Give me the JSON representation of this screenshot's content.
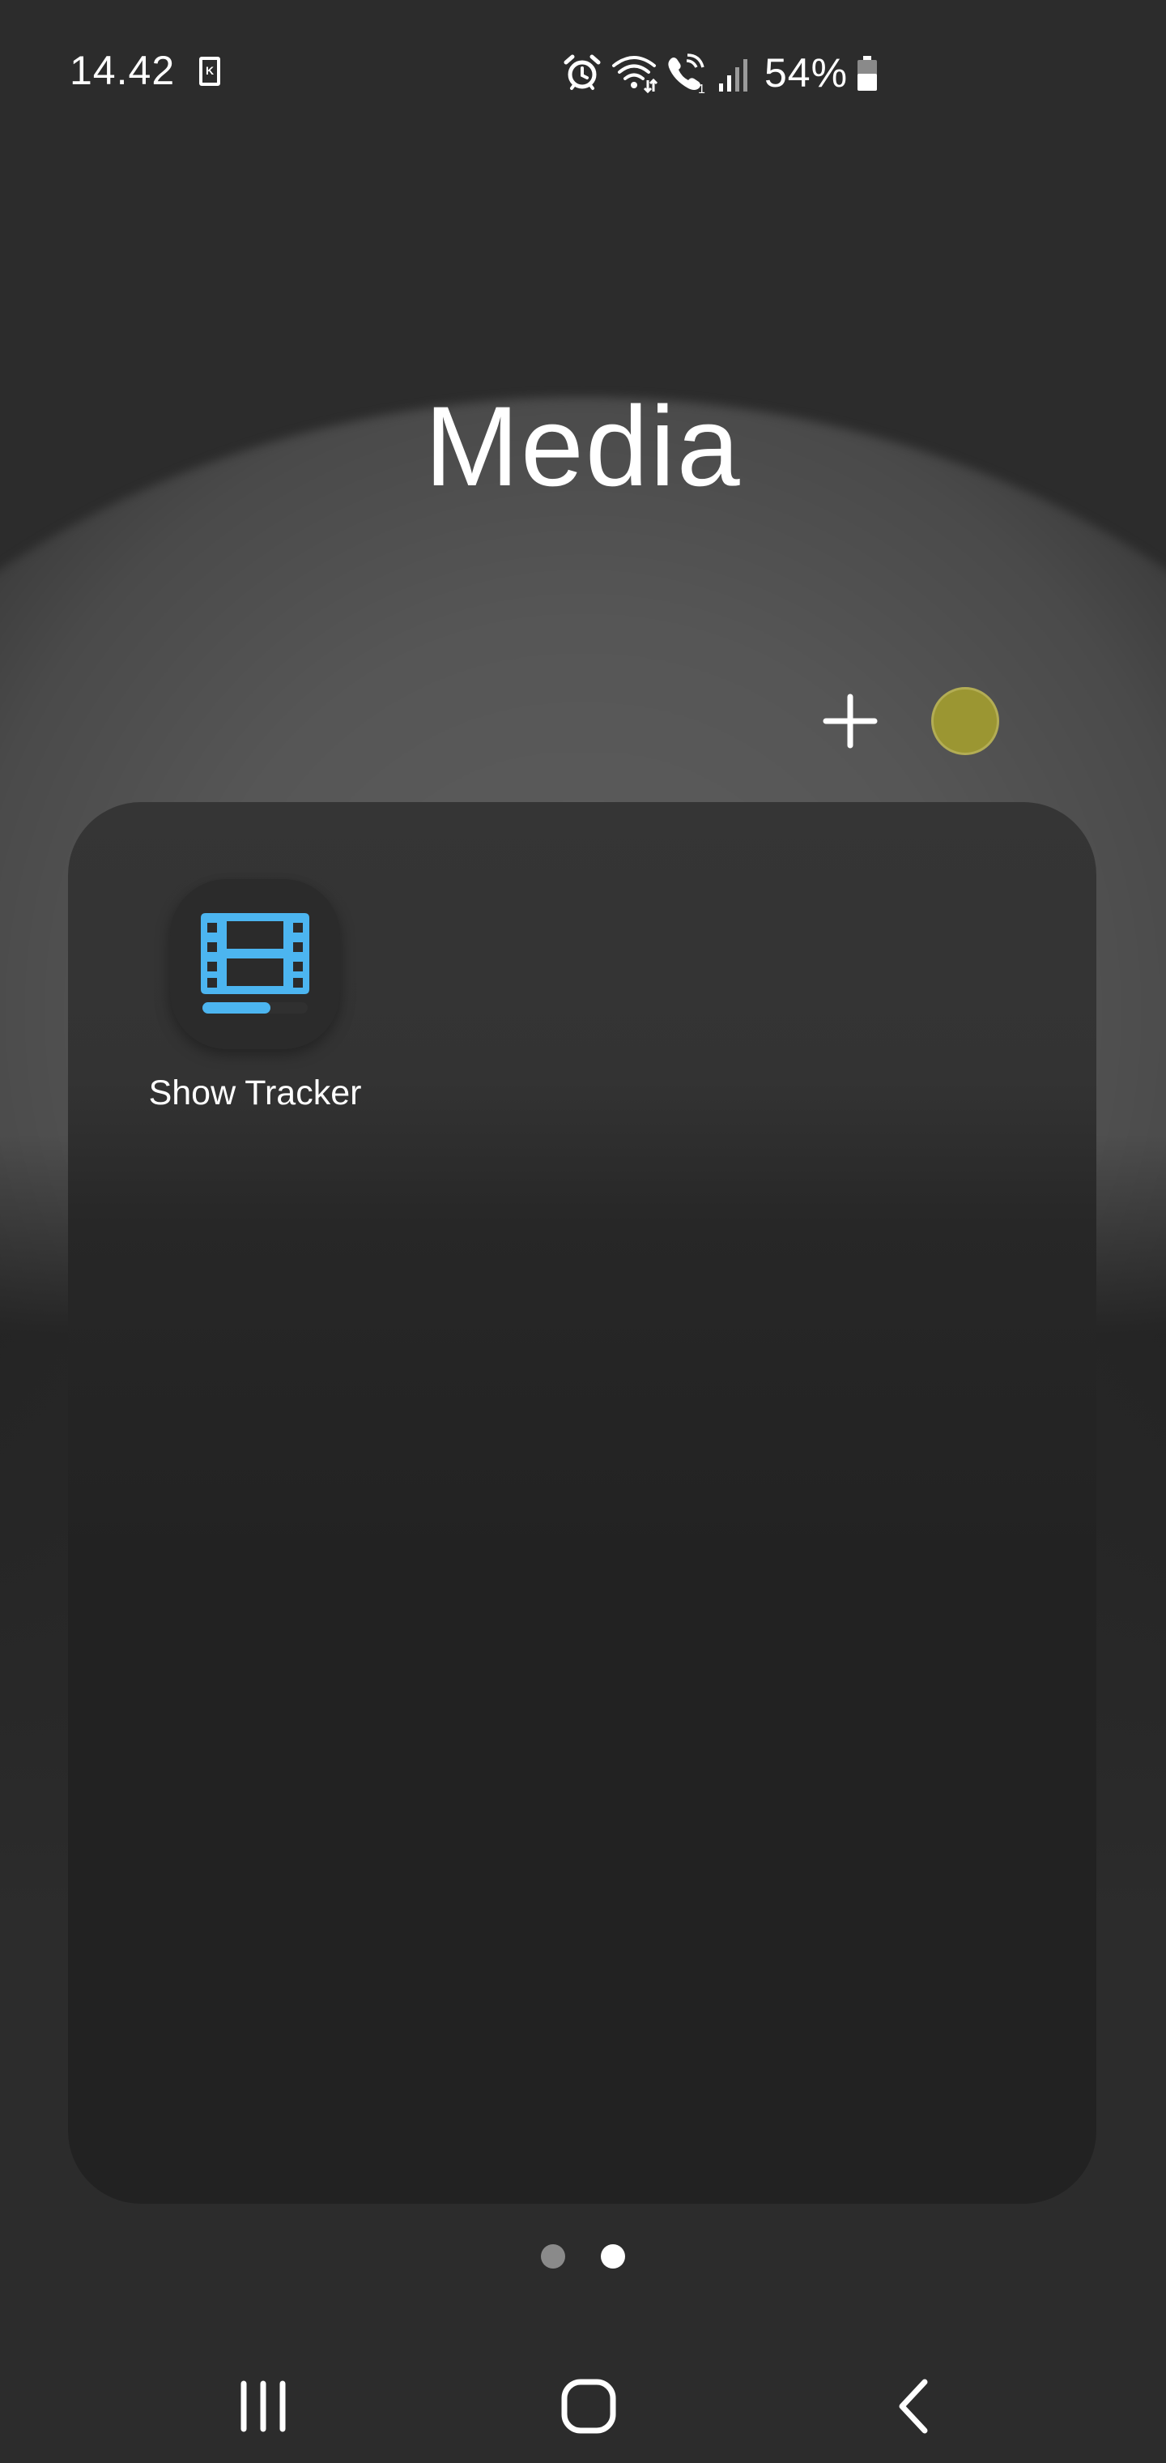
{
  "status_bar": {
    "time": "14.42",
    "sim_label": "K",
    "battery_percent": "54%",
    "battery_level": 0.54,
    "icons": [
      "sim-card-icon",
      "alarm-icon",
      "wifi-icon",
      "wifi-calling-icon",
      "signal-icon",
      "battery-icon"
    ]
  },
  "folder": {
    "title": "Media",
    "color": "#9b9632",
    "apps": [
      {
        "label": "Show Tracker",
        "icon": "film-strip-icon",
        "icon_color": "#4cb5f0"
      }
    ]
  },
  "pages": {
    "count": 2,
    "current": 2,
    "inactive_color": "#8a8a8a",
    "active_color": "#ffffff"
  },
  "navigation": {
    "buttons": [
      "recent-apps-icon",
      "home-icon",
      "back-icon"
    ]
  }
}
